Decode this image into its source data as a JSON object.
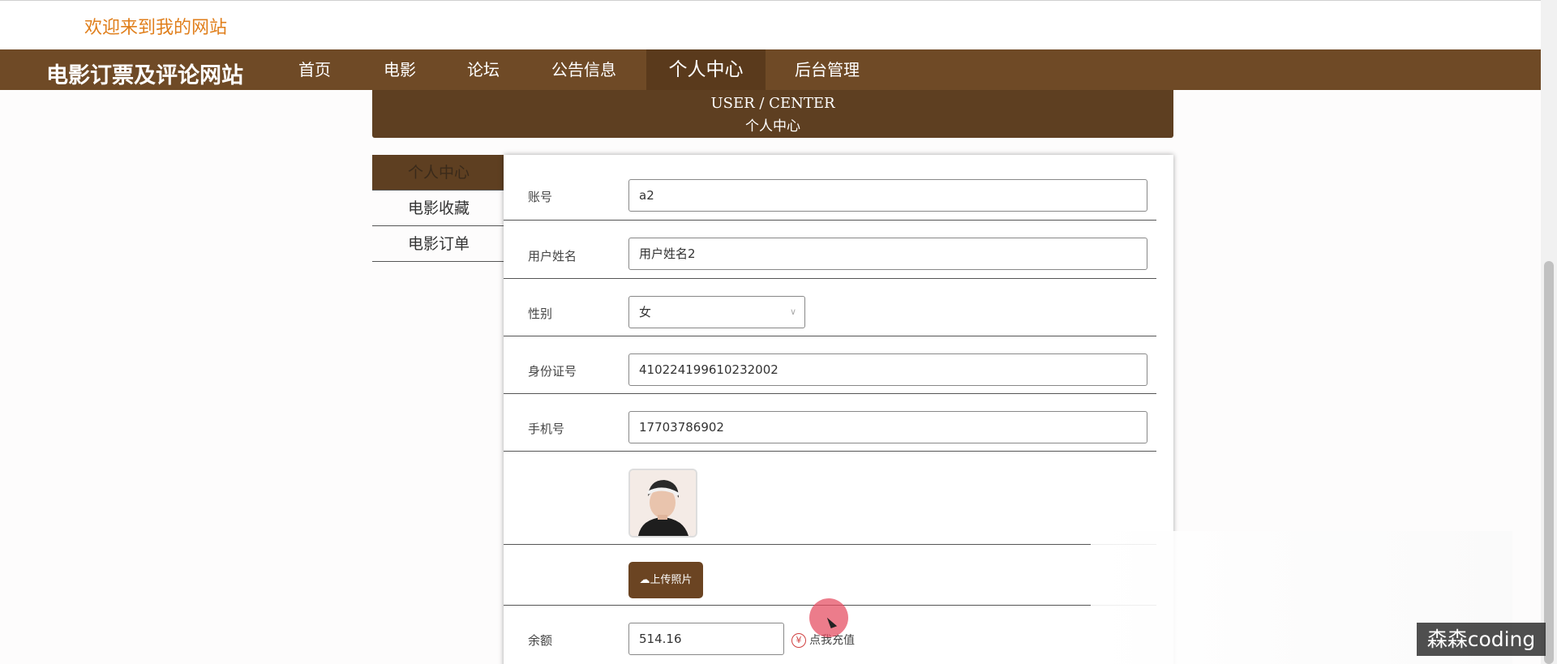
{
  "header": {
    "welcome": "欢迎来到我的网站"
  },
  "nav": {
    "brand": "电影订票及评论网站",
    "items": [
      {
        "label": "首页"
      },
      {
        "label": "电影"
      },
      {
        "label": "论坛"
      },
      {
        "label": "公告信息"
      },
      {
        "label": "个人中心",
        "active": true
      },
      {
        "label": "后台管理"
      }
    ]
  },
  "banner": {
    "title_en": "USER / CENTER",
    "title_cn": "个人中心"
  },
  "sidebar": {
    "items": [
      {
        "label": "个人中心",
        "active": true
      },
      {
        "label": "电影收藏"
      },
      {
        "label": "电影订单"
      }
    ]
  },
  "form": {
    "account": {
      "label": "账号",
      "value": "a2"
    },
    "username": {
      "label": "用户姓名",
      "value": "用户姓名2"
    },
    "gender": {
      "label": "性别",
      "value": "女"
    },
    "id_number": {
      "label": "身份证号",
      "value": "410224199610232002"
    },
    "phone": {
      "label": "手机号",
      "value": "17703786902"
    },
    "upload_label": "上传照片",
    "balance": {
      "label": "余额",
      "value": "514.16"
    },
    "recharge_label": "点我充值"
  },
  "watermark": "森森coding",
  "colors": {
    "nav_bg": "#6f4a26",
    "banner_bg": "#5e3f21",
    "welcome_text": "#e07f1c",
    "button_bg": "#6b4422"
  }
}
